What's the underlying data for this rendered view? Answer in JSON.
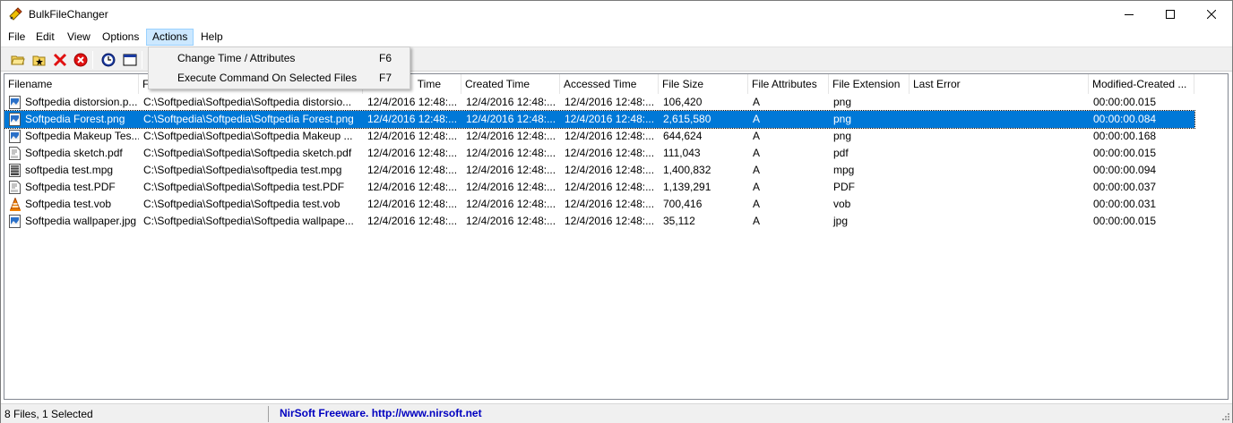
{
  "window": {
    "title": "BulkFileChanger"
  },
  "menu": [
    {
      "label": "File"
    },
    {
      "label": "Edit"
    },
    {
      "label": "View"
    },
    {
      "label": "Options"
    },
    {
      "label": "Actions"
    },
    {
      "label": "Help"
    }
  ],
  "toolbar": {
    "buttons": [
      {
        "icon": "open-folder-icon"
      },
      {
        "icon": "add-files-icon"
      },
      {
        "icon": "delete-icon"
      },
      {
        "icon": "remove-all-icon"
      },
      {
        "icon": "clock-icon"
      },
      {
        "icon": "window-icon"
      }
    ]
  },
  "actions_menu": {
    "items": [
      {
        "label": "Change Time / Attributes",
        "shortcut": "F6"
      },
      {
        "label": "Execute Command On Selected Files",
        "shortcut": "F7"
      }
    ]
  },
  "table": {
    "columns": [
      "Filename",
      "F",
      "Time",
      "Created Time",
      "Accessed Time",
      "File Size",
      "File Attributes",
      "File Extension",
      "Last Error",
      "Modified-Created ..."
    ],
    "rows": [
      {
        "filename": "Softpedia distorsion.p...",
        "path": "C:\\Softpedia\\Softpedia\\Softpedia distorsio...",
        "modified": "12/4/2016 12:48:...",
        "created": "12/4/2016 12:48:...",
        "accessed": "12/4/2016 12:48:...",
        "size": "106,420",
        "attr": "A",
        "ext": "png",
        "error": "",
        "diff": "00:00:00.015",
        "icon": "image-file-icon"
      },
      {
        "filename": "Softpedia Forest.png",
        "path": "C:\\Softpedia\\Softpedia\\Softpedia Forest.png",
        "modified": "12/4/2016 12:48:...",
        "created": "12/4/2016 12:48:...",
        "accessed": "12/4/2016 12:48:...",
        "size": "2,615,580",
        "attr": "A",
        "ext": "png",
        "error": "",
        "diff": "00:00:00.084",
        "icon": "image-file-icon",
        "selected": true
      },
      {
        "filename": "Softpedia Makeup Tes...",
        "path": "C:\\Softpedia\\Softpedia\\Softpedia Makeup ...",
        "modified": "12/4/2016 12:48:...",
        "created": "12/4/2016 12:48:...",
        "accessed": "12/4/2016 12:48:...",
        "size": "644,624",
        "attr": "A",
        "ext": "png",
        "error": "",
        "diff": "00:00:00.168",
        "icon": "image-file-icon"
      },
      {
        "filename": "Softpedia sketch.pdf",
        "path": "C:\\Softpedia\\Softpedia\\Softpedia sketch.pdf",
        "modified": "12/4/2016 12:48:...",
        "created": "12/4/2016 12:48:...",
        "accessed": "12/4/2016 12:48:...",
        "size": "111,043",
        "attr": "A",
        "ext": "pdf",
        "error": "",
        "diff": "00:00:00.015",
        "icon": "pdf-file-icon"
      },
      {
        "filename": "softpedia test.mpg",
        "path": "C:\\Softpedia\\Softpedia\\softpedia test.mpg",
        "modified": "12/4/2016 12:48:...",
        "created": "12/4/2016 12:48:...",
        "accessed": "12/4/2016 12:48:...",
        "size": "1,400,832",
        "attr": "A",
        "ext": "mpg",
        "error": "",
        "diff": "00:00:00.094",
        "icon": "video-file-icon"
      },
      {
        "filename": "Softpedia test.PDF",
        "path": "C:\\Softpedia\\Softpedia\\Softpedia test.PDF",
        "modified": "12/4/2016 12:48:...",
        "created": "12/4/2016 12:48:...",
        "accessed": "12/4/2016 12:48:...",
        "size": "1,139,291",
        "attr": "A",
        "ext": "PDF",
        "error": "",
        "diff": "00:00:00.037",
        "icon": "pdf-file-icon"
      },
      {
        "filename": "Softpedia test.vob",
        "path": "C:\\Softpedia\\Softpedia\\Softpedia test.vob",
        "modified": "12/4/2016 12:48:...",
        "created": "12/4/2016 12:48:...",
        "accessed": "12/4/2016 12:48:...",
        "size": "700,416",
        "attr": "A",
        "ext": "vob",
        "error": "",
        "diff": "00:00:00.031",
        "icon": "vlc-cone-icon"
      },
      {
        "filename": "Softpedia wallpaper.jpg",
        "path": "C:\\Softpedia\\Softpedia\\Softpedia wallpape...",
        "modified": "12/4/2016 12:48:...",
        "created": "12/4/2016 12:48:...",
        "accessed": "12/4/2016 12:48:...",
        "size": "35,112",
        "attr": "A",
        "ext": "jpg",
        "error": "",
        "diff": "00:00:00.015",
        "icon": "image-file-icon"
      }
    ]
  },
  "status": {
    "count": "8 Files, 1 Selected",
    "link": "NirSoft Freeware.  http://www.nirsoft.net"
  },
  "colors": {
    "selection": "#0078d7",
    "menu_highlight": "#cce8ff",
    "link": "#0000c0"
  }
}
